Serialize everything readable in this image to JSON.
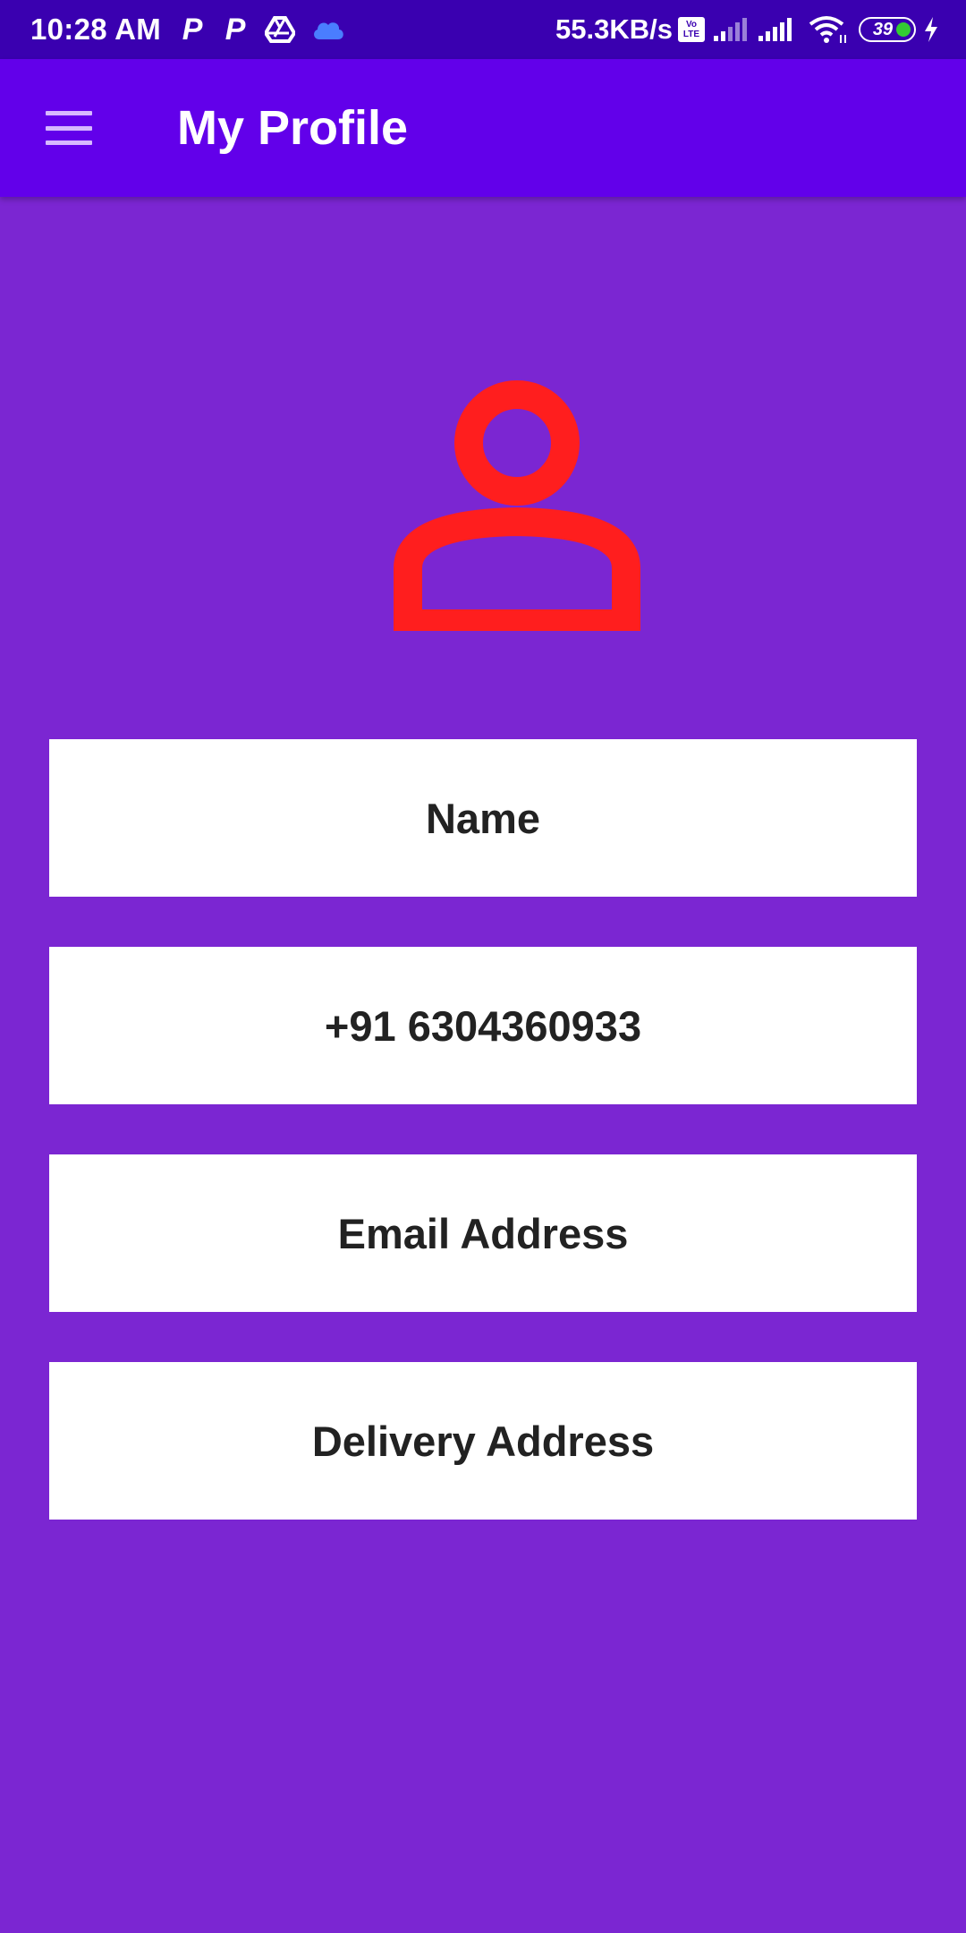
{
  "status_bar": {
    "time": "10:28 AM",
    "notification_icons": [
      "parking-p-icon",
      "parking-p-icon",
      "google-drive-icon",
      "cloud-icon"
    ],
    "net_speed": "55.3KB/s",
    "volte_top": "Vo",
    "volte_bottom": "LTE",
    "battery_level": "39",
    "signal_icons": [
      "cell-signal-weak-icon",
      "cell-signal-icon"
    ],
    "wifi_icon": "wifi-icon",
    "charging_icon": "charging-bolt-icon"
  },
  "app_bar": {
    "title": "My Profile",
    "menu_icon": "hamburger-menu-icon",
    "color": "#6200EA"
  },
  "avatar": {
    "icon": "person-outline-icon",
    "color": "#FF1E1E"
  },
  "fields": {
    "name": "Name",
    "phone": "+91 6304360933",
    "email": "Email Address",
    "delivery_address": "Delivery Address"
  },
  "colors": {
    "status_bar": "#3A00B0",
    "background": "#7B26D2",
    "card": "#FFFFFF",
    "card_text": "#222222"
  }
}
